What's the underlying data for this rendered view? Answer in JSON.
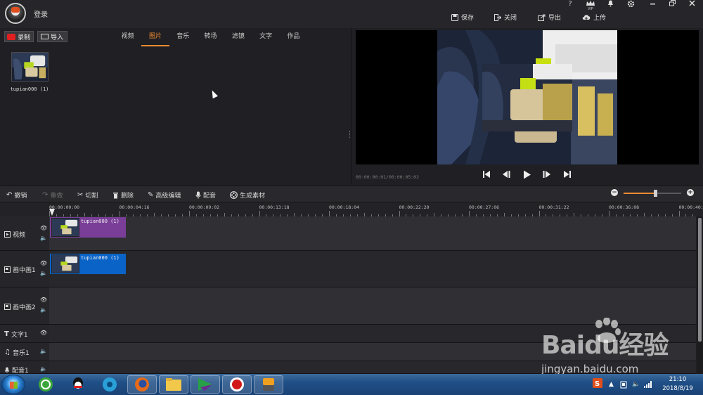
{
  "titlebar": {
    "login_label": "登录",
    "controls": [
      "?",
      "VIP",
      "bell-icon",
      "gear-icon",
      "minimize-icon",
      "restore-icon",
      "close-icon"
    ],
    "vip_label": "VIP",
    "help_label": "?",
    "actions": [
      {
        "label": "保存",
        "icon": "save-icon"
      },
      {
        "label": "关闭",
        "icon": "close-project-icon"
      },
      {
        "label": "导出",
        "icon": "export-icon"
      },
      {
        "label": "上传",
        "icon": "upload-icon"
      }
    ]
  },
  "media_panel": {
    "record_label": "录制",
    "import_label": "导入",
    "tabs": [
      "视频",
      "图片",
      "音乐",
      "转场",
      "滤镜",
      "文字",
      "作品"
    ],
    "active_tab": "图片",
    "items": [
      {
        "label": "tupian000 (1)"
      }
    ]
  },
  "preview": {
    "timecode": "00:00:00:01/00:00:05:02"
  },
  "toolbar": {
    "items": [
      {
        "label": "撤销",
        "icon": "undo-icon",
        "enabled": true
      },
      {
        "label": "重做",
        "icon": "redo-icon",
        "enabled": false
      },
      {
        "label": "切割",
        "icon": "scissors-icon",
        "enabled": true
      },
      {
        "label": "删除",
        "icon": "trash-icon",
        "enabled": true
      },
      {
        "label": "高级编辑",
        "icon": "pencil-icon",
        "enabled": true
      },
      {
        "label": "配音",
        "icon": "microphone-icon",
        "enabled": true
      },
      {
        "label": "生成素材",
        "icon": "film-reel-icon",
        "enabled": true
      }
    ],
    "zoom_level": 0.55
  },
  "ruler": {
    "ticks": [
      "00:00:00:00",
      "00:00:04:16",
      "00:00:09:02",
      "00:00:13:18",
      "00:00:18:04",
      "00:00:22:20",
      "00:00:27:06",
      "00:00:31:22",
      "00:00:36:08",
      "00:00:40:"
    ]
  },
  "tracks": [
    {
      "label": "视频",
      "clip": "tupian000 (1)",
      "clip_color": "#7a3e98"
    },
    {
      "label": "画中画1",
      "clip": "tupian000 (1)",
      "clip_color": "#0a64c8"
    },
    {
      "label": "画中画2",
      "clip": null
    },
    {
      "label": "文字1",
      "clip": null
    },
    {
      "label": "音乐1",
      "clip": null
    },
    {
      "label": "配音1",
      "clip": null
    }
  ],
  "watermark": {
    "main": "Baidu经验",
    "sub": "jingyan.baidu.com"
  },
  "taskbar": {
    "apps": [
      "360-icon",
      "qq-icon",
      "media-player-icon",
      "firefox-icon",
      "explorer-icon",
      "video-app-icon",
      "record-icon",
      "editor-app-icon"
    ],
    "time": "21:10",
    "date": "2018/8/19"
  },
  "colors": {
    "accent": "#f08a30",
    "video_clip": "#7a3e98",
    "pip_clip": "#0a64c8",
    "record_red": "#e02020"
  }
}
